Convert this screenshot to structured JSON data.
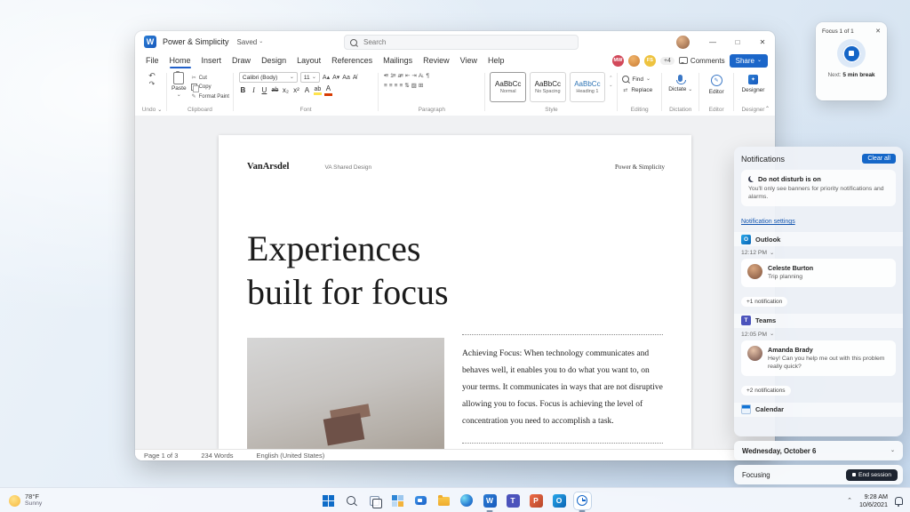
{
  "icons": {
    "chevron_down": "⌄",
    "chevron_up": "⌃",
    "close": "✕",
    "minimize": "—",
    "maximize": "□",
    "w": "W",
    "t": "T",
    "p": "P",
    "o": "O"
  },
  "word": {
    "title": "Power & Simplicity",
    "saved": "Saved",
    "search_placeholder": "Search",
    "menu": [
      "File",
      "Home",
      "Insert",
      "Draw",
      "Design",
      "Layout",
      "References",
      "Mailings",
      "Review",
      "View",
      "Help"
    ],
    "collab": {
      "a1": "MW",
      "a3": "FS",
      "overflow": "+4",
      "comments": "Comments",
      "share": "Share"
    },
    "ribbon": {
      "undo": "Undo",
      "paste": "Paste",
      "cut": "Cut",
      "copy": "Copy",
      "format_paint": "Format Paint",
      "clipboard": "Clipboard",
      "font_name": "Calibri (Body)",
      "font_size": "11",
      "font": "Font",
      "fmt": {
        "bold": "B",
        "italic": "I",
        "underline": "U",
        "strike": "ab",
        "subscript": "x₂",
        "superscript": "x²",
        "effects": "A",
        "highlight": "ab",
        "font_color": "A",
        "grow": "A▴",
        "shrink": "A▾",
        "case": "Aa"
      },
      "paragraph": "Paragraph",
      "style": "Style",
      "styles": [
        {
          "sample": "AaBbCc",
          "name": "Normal"
        },
        {
          "sample": "AaBbCc",
          "name": "No Spacing"
        },
        {
          "sample": "AaBbCc",
          "name": "Heading 1"
        }
      ],
      "find": "Find",
      "replace": "Replace",
      "editing": "Editing",
      "dictate": "Dictate",
      "dictation": "Dictation",
      "editor": "Editor",
      "designer": "Designer"
    },
    "doc": {
      "brand": "VanArsdel",
      "brand_sub": "VA Shared Design",
      "header_right": "Power & Simplicity",
      "heading1": "Experiences",
      "heading2": "built for focus",
      "body": "Achieving Focus: When technology communicates and behaves well, it enables you to do what you want to, on your terms. It communicates in ways that are not disruptive allowing you to focus. Focus is achieving the level of concentration you need to accomplish a task."
    },
    "status": {
      "page": "Page 1 of 3",
      "words": "234 Words",
      "lang": "English (United States)"
    }
  },
  "focus_widget": {
    "title": "Focus 1 of 1",
    "next_label": "Next:",
    "next_value": "5 min break"
  },
  "panel": {
    "title": "Notifications",
    "clear_all": "Clear all",
    "dnd_title": "Do not disturb is on",
    "dnd_desc": "You'll only see banners for priority notifications and alarms.",
    "settings": "Notification settings",
    "outlook": {
      "app": "Outlook",
      "time": "12:12 PM",
      "name": "Celeste Burton",
      "msg": "Trip planning",
      "more": "+1 notification"
    },
    "teams": {
      "app": "Teams",
      "time": "12:05 PM",
      "name": "Amanda Brady",
      "msg": "Hey! Can you help me out with this problem really quick?",
      "more": "+2 notifications"
    },
    "calendar": {
      "app": "Calendar"
    },
    "date_card": "Wednesday, October 6",
    "focusing": "Focusing",
    "end_session": "End session"
  },
  "taskbar": {
    "temp": "78°F",
    "weather": "Sunny",
    "time": "9:28 AM",
    "date": "10/6/2021",
    "icons": [
      "start",
      "search",
      "task-view",
      "widgets",
      "chat",
      "file-explorer",
      "edge",
      "word",
      "teams",
      "powerpoint",
      "outlook",
      "clock"
    ]
  },
  "colors": {
    "accent": "#1466c8",
    "word_blue": "#185abd",
    "share_button": "#1b66c9",
    "end_session_bg": "#1d2430"
  }
}
